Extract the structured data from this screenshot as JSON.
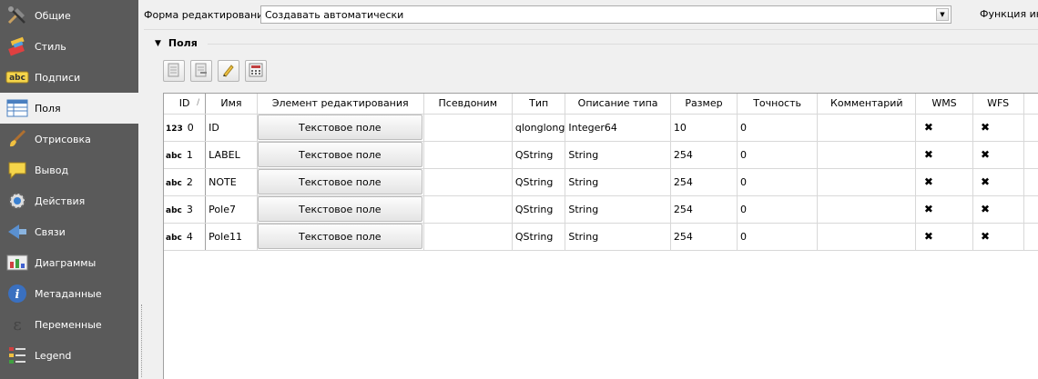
{
  "sidebar": {
    "items": [
      {
        "label": "Общие",
        "icon": "tools-icon"
      },
      {
        "label": "Стиль",
        "icon": "brush-icon"
      },
      {
        "label": "Подписи",
        "icon": "abc-label-icon"
      },
      {
        "label": "Поля",
        "icon": "table-icon"
      },
      {
        "label": "Отрисовка",
        "icon": "paintbrush-icon"
      },
      {
        "label": "Вывод",
        "icon": "speech-bubble-icon"
      },
      {
        "label": "Действия",
        "icon": "gear-icon"
      },
      {
        "label": "Связи",
        "icon": "join-icon"
      },
      {
        "label": "Диаграммы",
        "icon": "diagram-icon"
      },
      {
        "label": "Метаданные",
        "icon": "info-icon"
      },
      {
        "label": "Переменные",
        "icon": "variable-icon"
      },
      {
        "label": "Legend",
        "icon": "legend-icon"
      }
    ],
    "active_index": 3
  },
  "form": {
    "label": "Форма редактирования:",
    "value": "Создавать автоматически",
    "function_label": "Функция ини"
  },
  "fields_group": {
    "title": "Поля"
  },
  "table": {
    "headers": [
      "ID",
      "Имя",
      "Элемент редактирования",
      "Псевдоним",
      "Тип",
      "Описание типа",
      "Размер",
      "Точность",
      "Комментарий",
      "WMS",
      "WFS"
    ],
    "rows": [
      {
        "badge": "123",
        "id": "0",
        "name": "ID",
        "widget": "Текстовое поле",
        "alias": "",
        "type": "qlonglong",
        "type_desc": "Integer64",
        "length": "10",
        "precision": "0",
        "comment": "",
        "wms": true,
        "wfs": true
      },
      {
        "badge": "abc",
        "id": "1",
        "name": "LABEL",
        "widget": "Текстовое поле",
        "alias": "",
        "type": "QString",
        "type_desc": "String",
        "length": "254",
        "precision": "0",
        "comment": "",
        "wms": true,
        "wfs": true
      },
      {
        "badge": "abc",
        "id": "2",
        "name": "NOTE",
        "widget": "Текстовое поле",
        "alias": "",
        "type": "QString",
        "type_desc": "String",
        "length": "254",
        "precision": "0",
        "comment": "",
        "wms": true,
        "wfs": true
      },
      {
        "badge": "abc",
        "id": "3",
        "name": "Pole7",
        "widget": "Текстовое поле",
        "alias": "",
        "type": "QString",
        "type_desc": "String",
        "length": "254",
        "precision": "0",
        "comment": "",
        "wms": true,
        "wfs": true
      },
      {
        "badge": "abc",
        "id": "4",
        "name": "Pole11",
        "widget": "Текстовое поле",
        "alias": "",
        "type": "QString",
        "type_desc": "String",
        "length": "254",
        "precision": "0",
        "comment": "",
        "wms": true,
        "wfs": true
      }
    ]
  }
}
